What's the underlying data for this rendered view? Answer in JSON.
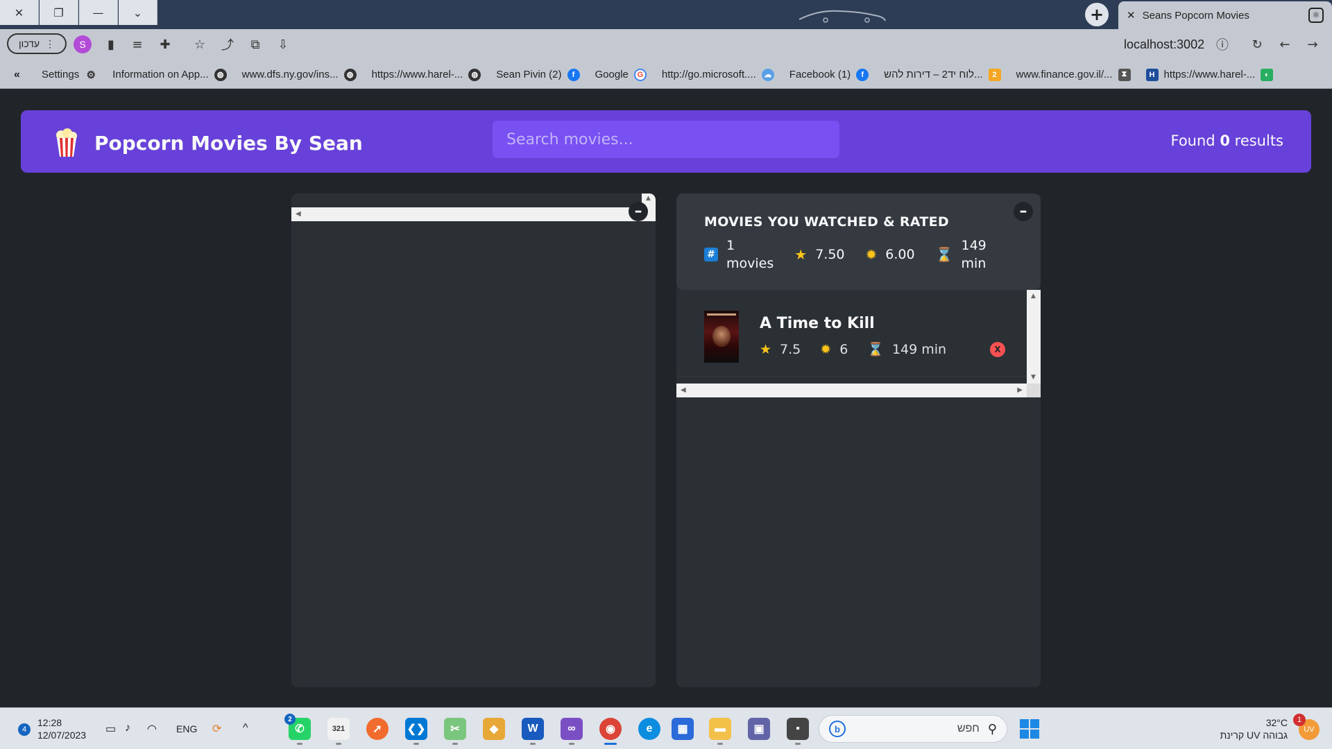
{
  "browser": {
    "tab_title": "Seans Popcorn Movies",
    "url": "localhost:3002",
    "update_label": "עדכון",
    "profile_initial": "S",
    "bookmarks": [
      {
        "label": "Settings",
        "icon": "gear-icon"
      },
      {
        "label": "Information on App...",
        "icon": "globe-icon"
      },
      {
        "label": "www.dfs.ny.gov/ins...",
        "icon": "globe-icon"
      },
      {
        "label": "https://www.harel-...",
        "icon": "globe-icon"
      },
      {
        "label": "Sean Pivin (2)",
        "icon": "facebook-icon"
      },
      {
        "label": "Google",
        "icon": "google-icon"
      },
      {
        "label": "http://go.microsoft....",
        "icon": "cloud-icon"
      },
      {
        "label": "Facebook (1)",
        "icon": "facebook-icon"
      },
      {
        "label": "לוח יד2 – דירות להש...",
        "icon": "yad2-icon"
      },
      {
        "label": "www.finance.gov.il/...",
        "icon": "hourglass-icon"
      },
      {
        "label": "https://www.harel-...",
        "icon": "harel-icon"
      }
    ]
  },
  "app": {
    "logo_icon": "🍿",
    "title": "Popcorn Movies By Sean",
    "search_placeholder": "Search movies...",
    "results_prefix": "Found",
    "results_count": "0",
    "results_suffix": "results"
  },
  "summary": {
    "title": "MOVIES YOU WATCHED & RATED",
    "movies_count": "1",
    "movies_unit": "movies",
    "avg_imdb": "7.50",
    "avg_user": "6.00",
    "avg_runtime": "149",
    "runtime_unit": "min"
  },
  "watched": [
    {
      "title": "A Time to Kill",
      "imdb_rating": "7.5",
      "user_rating": "6",
      "runtime": "149 min",
      "delete_label": "X"
    }
  ],
  "toggle_label": "–",
  "taskbar": {
    "time": "12:28",
    "date": "12/07/2023",
    "notification_count": "4",
    "language": "ENG",
    "whatsapp_badge": "2",
    "search_text": "חפש",
    "temperature": "32°C",
    "weather_text": "קרינת UV גבוהה",
    "weather_badge": "1"
  },
  "colors": {
    "primary": "#6741d9",
    "primary_light": "#7950f2",
    "background": "#212529",
    "box": "#2b3035",
    "summary": "#343a40",
    "delete": "#fa5252"
  }
}
